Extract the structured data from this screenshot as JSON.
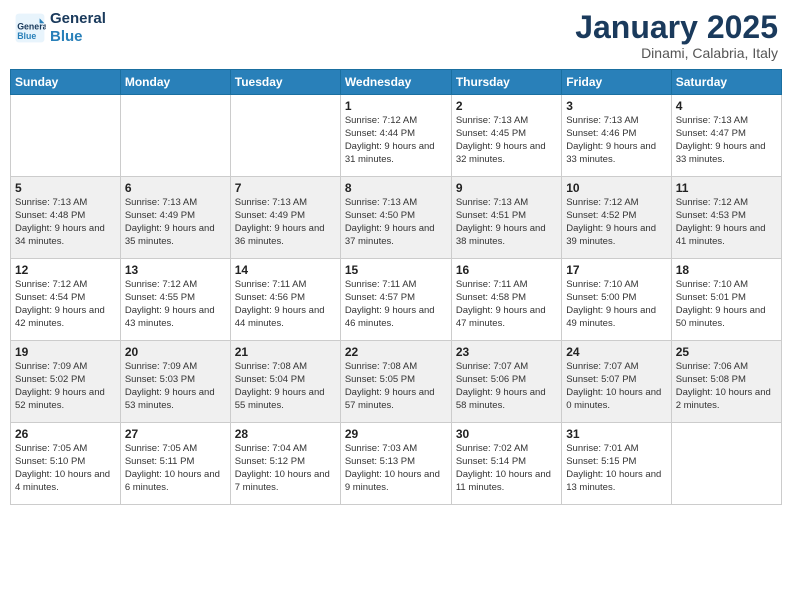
{
  "logo": {
    "line1": "General",
    "line2": "Blue"
  },
  "title": "January 2025",
  "subtitle": "Dinami, Calabria, Italy",
  "days_header": [
    "Sunday",
    "Monday",
    "Tuesday",
    "Wednesday",
    "Thursday",
    "Friday",
    "Saturday"
  ],
  "weeks": [
    [
      {
        "day": "",
        "info": ""
      },
      {
        "day": "",
        "info": ""
      },
      {
        "day": "",
        "info": ""
      },
      {
        "day": "1",
        "info": "Sunrise: 7:12 AM\nSunset: 4:44 PM\nDaylight: 9 hours and 31 minutes."
      },
      {
        "day": "2",
        "info": "Sunrise: 7:13 AM\nSunset: 4:45 PM\nDaylight: 9 hours and 32 minutes."
      },
      {
        "day": "3",
        "info": "Sunrise: 7:13 AM\nSunset: 4:46 PM\nDaylight: 9 hours and 33 minutes."
      },
      {
        "day": "4",
        "info": "Sunrise: 7:13 AM\nSunset: 4:47 PM\nDaylight: 9 hours and 33 minutes."
      }
    ],
    [
      {
        "day": "5",
        "info": "Sunrise: 7:13 AM\nSunset: 4:48 PM\nDaylight: 9 hours and 34 minutes."
      },
      {
        "day": "6",
        "info": "Sunrise: 7:13 AM\nSunset: 4:49 PM\nDaylight: 9 hours and 35 minutes."
      },
      {
        "day": "7",
        "info": "Sunrise: 7:13 AM\nSunset: 4:49 PM\nDaylight: 9 hours and 36 minutes."
      },
      {
        "day": "8",
        "info": "Sunrise: 7:13 AM\nSunset: 4:50 PM\nDaylight: 9 hours and 37 minutes."
      },
      {
        "day": "9",
        "info": "Sunrise: 7:13 AM\nSunset: 4:51 PM\nDaylight: 9 hours and 38 minutes."
      },
      {
        "day": "10",
        "info": "Sunrise: 7:12 AM\nSunset: 4:52 PM\nDaylight: 9 hours and 39 minutes."
      },
      {
        "day": "11",
        "info": "Sunrise: 7:12 AM\nSunset: 4:53 PM\nDaylight: 9 hours and 41 minutes."
      }
    ],
    [
      {
        "day": "12",
        "info": "Sunrise: 7:12 AM\nSunset: 4:54 PM\nDaylight: 9 hours and 42 minutes."
      },
      {
        "day": "13",
        "info": "Sunrise: 7:12 AM\nSunset: 4:55 PM\nDaylight: 9 hours and 43 minutes."
      },
      {
        "day": "14",
        "info": "Sunrise: 7:11 AM\nSunset: 4:56 PM\nDaylight: 9 hours and 44 minutes."
      },
      {
        "day": "15",
        "info": "Sunrise: 7:11 AM\nSunset: 4:57 PM\nDaylight: 9 hours and 46 minutes."
      },
      {
        "day": "16",
        "info": "Sunrise: 7:11 AM\nSunset: 4:58 PM\nDaylight: 9 hours and 47 minutes."
      },
      {
        "day": "17",
        "info": "Sunrise: 7:10 AM\nSunset: 5:00 PM\nDaylight: 9 hours and 49 minutes."
      },
      {
        "day": "18",
        "info": "Sunrise: 7:10 AM\nSunset: 5:01 PM\nDaylight: 9 hours and 50 minutes."
      }
    ],
    [
      {
        "day": "19",
        "info": "Sunrise: 7:09 AM\nSunset: 5:02 PM\nDaylight: 9 hours and 52 minutes."
      },
      {
        "day": "20",
        "info": "Sunrise: 7:09 AM\nSunset: 5:03 PM\nDaylight: 9 hours and 53 minutes."
      },
      {
        "day": "21",
        "info": "Sunrise: 7:08 AM\nSunset: 5:04 PM\nDaylight: 9 hours and 55 minutes."
      },
      {
        "day": "22",
        "info": "Sunrise: 7:08 AM\nSunset: 5:05 PM\nDaylight: 9 hours and 57 minutes."
      },
      {
        "day": "23",
        "info": "Sunrise: 7:07 AM\nSunset: 5:06 PM\nDaylight: 9 hours and 58 minutes."
      },
      {
        "day": "24",
        "info": "Sunrise: 7:07 AM\nSunset: 5:07 PM\nDaylight: 10 hours and 0 minutes."
      },
      {
        "day": "25",
        "info": "Sunrise: 7:06 AM\nSunset: 5:08 PM\nDaylight: 10 hours and 2 minutes."
      }
    ],
    [
      {
        "day": "26",
        "info": "Sunrise: 7:05 AM\nSunset: 5:10 PM\nDaylight: 10 hours and 4 minutes."
      },
      {
        "day": "27",
        "info": "Sunrise: 7:05 AM\nSunset: 5:11 PM\nDaylight: 10 hours and 6 minutes."
      },
      {
        "day": "28",
        "info": "Sunrise: 7:04 AM\nSunset: 5:12 PM\nDaylight: 10 hours and 7 minutes."
      },
      {
        "day": "29",
        "info": "Sunrise: 7:03 AM\nSunset: 5:13 PM\nDaylight: 10 hours and 9 minutes."
      },
      {
        "day": "30",
        "info": "Sunrise: 7:02 AM\nSunset: 5:14 PM\nDaylight: 10 hours and 11 minutes."
      },
      {
        "day": "31",
        "info": "Sunrise: 7:01 AM\nSunset: 5:15 PM\nDaylight: 10 hours and 13 minutes."
      },
      {
        "day": "",
        "info": ""
      }
    ]
  ]
}
